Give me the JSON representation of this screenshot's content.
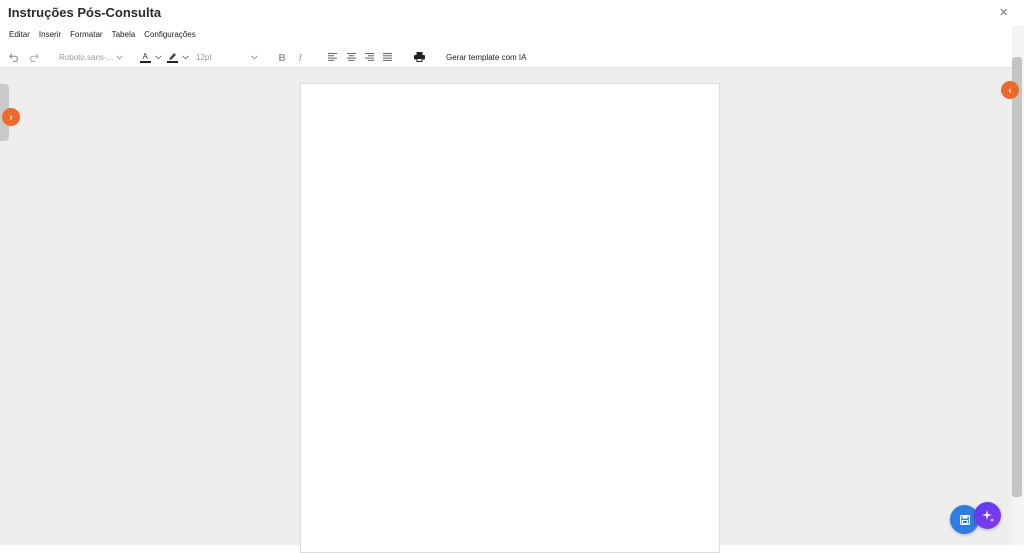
{
  "window": {
    "title": "Instruções Pós-Consulta",
    "close_glyph": "×"
  },
  "menu": [
    "Editar",
    "Inserir",
    "Formatar",
    "Tabela",
    "Configurações"
  ],
  "toolbar": {
    "font_family": "Roboto,sans-...",
    "font_size": "12pt",
    "ai_template_label": "Gerar template com IA",
    "icons": [
      "undo-icon",
      "redo-icon",
      "text-color-icon",
      "highlight-icon",
      "bold-icon",
      "italic-icon",
      "align-left-icon",
      "align-center-icon",
      "align-right-icon",
      "align-justify-icon",
      "print-icon"
    ]
  },
  "side_toggles": {
    "left_glyph": "›",
    "right_glyph": "‹"
  },
  "fabs": [
    "save-icon",
    "sparkle-icon"
  ],
  "colors": {
    "accent_orange": "#ee6a2a",
    "fab_blue": "#2f7de1",
    "fab_purple": "#6a3aee",
    "canvas_bg": "#eeeeee"
  }
}
